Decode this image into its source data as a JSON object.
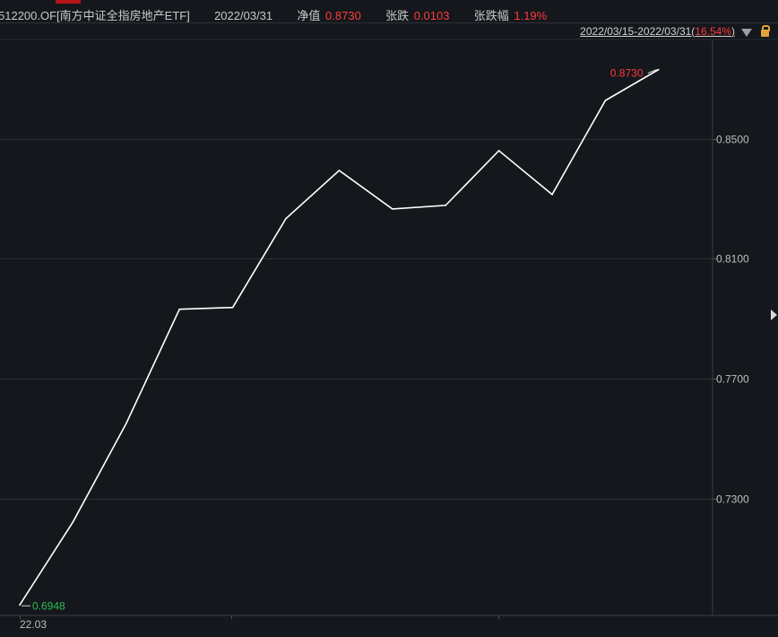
{
  "header": {
    "code_name": "512200.OF[南方中证全指房地产ETF]",
    "date": "2022/03/31",
    "nav_label": "净值",
    "nav_value": "0.8730",
    "change_label": "张跌",
    "change_value": "0.0103",
    "change_pct_label": "张跌幅",
    "change_pct_value": "1.19%"
  },
  "range": {
    "text": "2022/03/15-2022/03/31",
    "pct": "16.54%"
  },
  "colors": {
    "background": "#14171c",
    "line": "#ffffff",
    "grid": "#2c3038",
    "up": "#ff3b3b",
    "down": "#2bbd55"
  },
  "icons": [
    "dropdown-triangle-icon",
    "lock-icon",
    "expand-arrow-icon"
  ],
  "chart_data": {
    "type": "line",
    "y_ticks": [
      "0.8500",
      "0.8100",
      "0.7700",
      "0.7300"
    ],
    "ylim": [
      0.6913,
      0.883
    ],
    "x_start_label": "22.03",
    "series": [
      {
        "values": [
          0.6948,
          0.7224,
          0.7552,
          0.7932,
          0.7938,
          0.8234,
          0.8394,
          0.8266,
          0.8278,
          0.846,
          0.8314,
          0.8627,
          0.873
        ]
      }
    ],
    "max_label": "0.8730",
    "min_label": "0.6948"
  }
}
